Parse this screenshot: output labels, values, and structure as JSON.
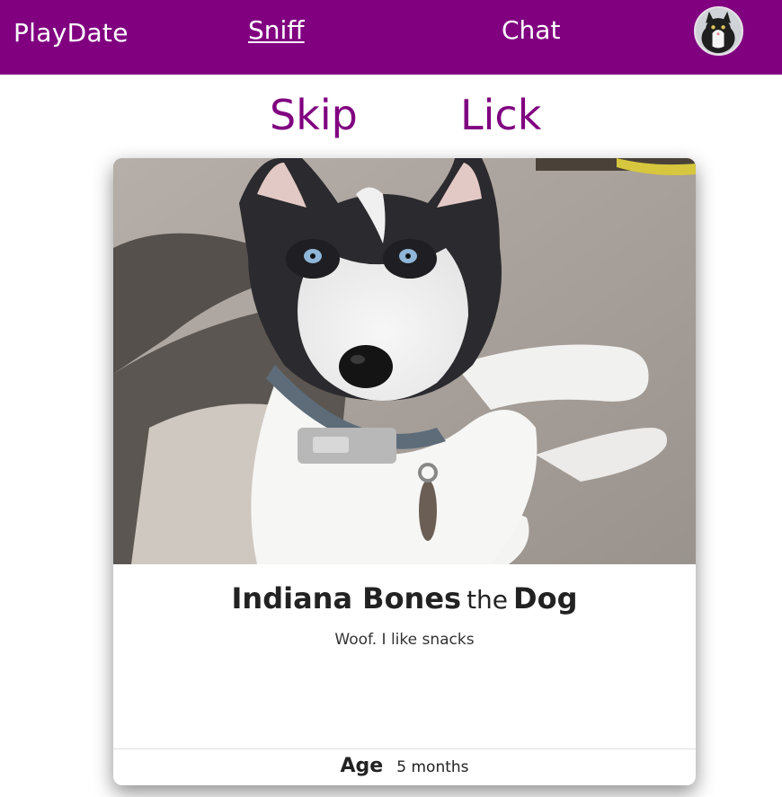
{
  "nav": {
    "brand": "PlayDate",
    "links": [
      {
        "label": "Sniff",
        "active": true
      },
      {
        "label": "Chat",
        "active": false
      }
    ],
    "avatar_icon": "cat-avatar-icon"
  },
  "actions": {
    "skip_label": "Skip",
    "lick_label": "Lick"
  },
  "profile": {
    "name": "Indiana Bones",
    "connector": "the",
    "species": "Dog",
    "bio": "Woof. I like snacks",
    "age_label": "Age",
    "age_value": "5 months",
    "photo": "husky-puppy-photo"
  },
  "colors": {
    "brand_purple": "#800080",
    "text_dark": "#222222"
  }
}
